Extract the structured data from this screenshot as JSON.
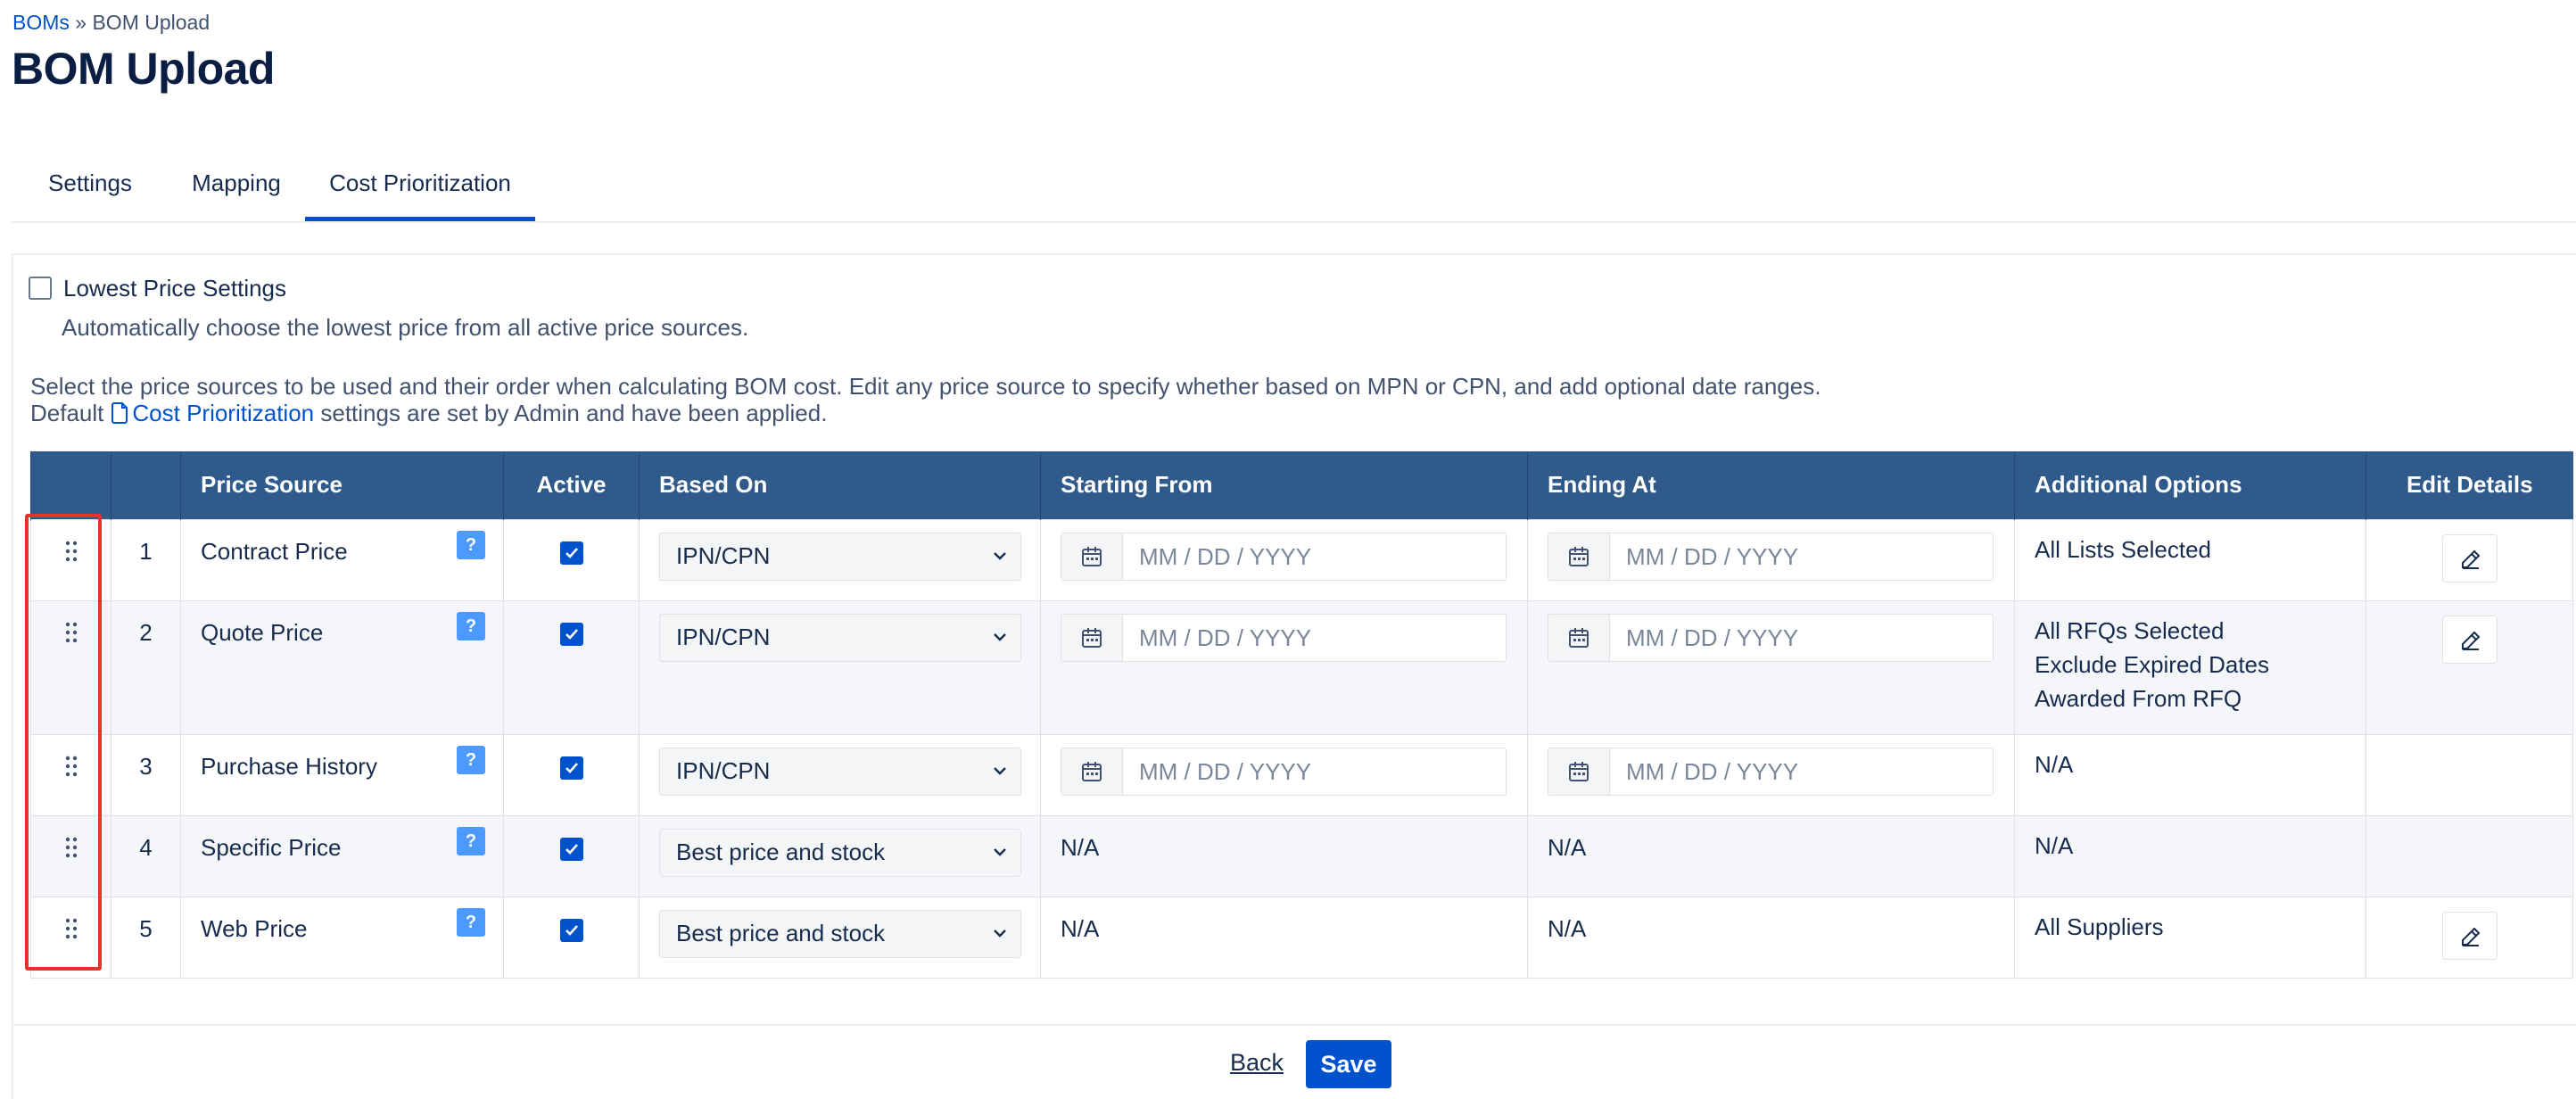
{
  "breadcrumb": {
    "root": "BOMs",
    "separator": "»",
    "current": "BOM Upload"
  },
  "page_title": "BOM Upload",
  "tabs": [
    {
      "label": "Settings",
      "active": false
    },
    {
      "label": "Mapping",
      "active": false
    },
    {
      "label": "Cost Prioritization",
      "active": true
    }
  ],
  "lowest_price": {
    "checked": false,
    "label": "Lowest Price Settings",
    "description": "Automatically choose the lowest price from all active price sources."
  },
  "intro": {
    "line1": "Select the price sources to be used and their order when calculating BOM cost. Edit any price source to specify whether based on MPN or CPN, and add optional date ranges.",
    "line2_prefix": "Default",
    "line2_link": "Cost Prioritization",
    "line2_suffix": "settings are set by Admin and have been applied."
  },
  "table": {
    "columns": [
      "",
      "",
      "Price Source",
      "Active",
      "Based On",
      "Starting From",
      "Ending At",
      "Additional Options",
      "Edit Details"
    ],
    "rows": [
      {
        "num": "1",
        "source": "Contract Price",
        "help": "?",
        "active": true,
        "based_on": "IPN/CPN",
        "start": "MM / DD / YYYY",
        "end": "MM / DD / YYYY",
        "options": [
          "All Lists Selected"
        ],
        "editable": true
      },
      {
        "num": "2",
        "source": "Quote Price",
        "help": "?",
        "active": true,
        "based_on": "IPN/CPN",
        "start": "MM / DD / YYYY",
        "end": "MM / DD / YYYY",
        "options": [
          "All RFQs Selected",
          "Exclude Expired Dates",
          "Awarded From RFQ"
        ],
        "editable": true
      },
      {
        "num": "3",
        "source": "Purchase History",
        "help": "?",
        "active": true,
        "based_on": "IPN/CPN",
        "start": "MM / DD / YYYY",
        "end": "MM / DD / YYYY",
        "options": [
          "N/A"
        ],
        "editable": false
      },
      {
        "num": "4",
        "source": "Specific Price",
        "help": "?",
        "active": true,
        "based_on": "Best price and stock",
        "start_text": "N/A",
        "end_text": "N/A",
        "options": [
          "N/A"
        ],
        "editable": false
      },
      {
        "num": "5",
        "source": "Web Price",
        "help": "?",
        "active": true,
        "based_on": "Best price and stock",
        "start_text": "N/A",
        "end_text": "N/A",
        "options": [
          "All Suppliers"
        ],
        "editable": true
      }
    ]
  },
  "footer": {
    "back": "Back",
    "save": "Save"
  },
  "icons": {
    "drag": "drag-handle-icon",
    "help": "help-icon",
    "check": "checkmark-icon",
    "chevron": "chevron-down-icon",
    "calendar": "calendar-icon",
    "edit": "pencil-icon",
    "doc": "document-icon"
  },
  "colors": {
    "header": "#2f5a8a",
    "accent": "#0052cc",
    "help": "#4c9aff",
    "highlight": "#e5322d"
  }
}
